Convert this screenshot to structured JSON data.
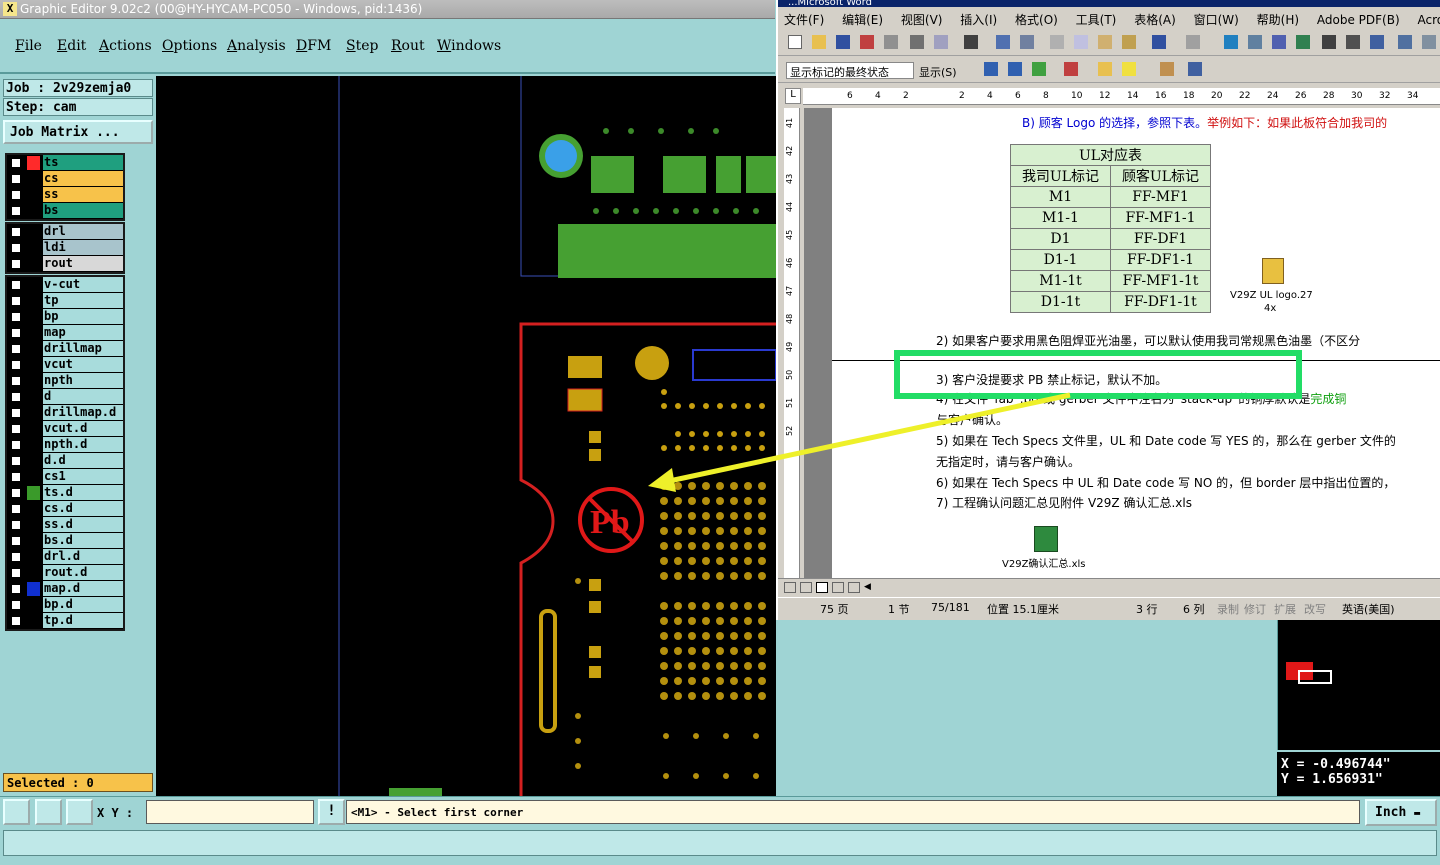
{
  "ge_title": "Graphic Editor 9.02c2 (00@HY-HYCAM-PC050 - Windows, pid:1436)",
  "ge_menu": [
    "File",
    "Edit",
    "Actions",
    "Options",
    "Analysis",
    "DFM",
    "Step",
    "Rout",
    "Windows"
  ],
  "job": "Job : 2v29zemja0",
  "step": "Step: cam",
  "job_matrix": "Job Matrix ...",
  "layer_groups": [
    [
      {
        "name": "ts",
        "color": "#1f9f7f",
        "mark": "#ff2a2a"
      },
      {
        "name": "cs",
        "color": "#f7c24a",
        "mark": ""
      },
      {
        "name": "ss",
        "color": "#f7c24a",
        "mark": ""
      },
      {
        "name": "bs",
        "color": "#1f9f7f",
        "mark": ""
      }
    ],
    [
      {
        "name": "drl",
        "color": "#a8c4cc",
        "mark": ""
      },
      {
        "name": "ldi",
        "color": "#a8c4cc",
        "mark": ""
      },
      {
        "name": "rout",
        "color": "#d8d8d8",
        "mark": ""
      }
    ],
    [
      {
        "name": "v-cut",
        "color": "#a8dcdc",
        "mark": ""
      },
      {
        "name": "tp",
        "color": "#a8dcdc",
        "mark": ""
      },
      {
        "name": "bp",
        "color": "#a8dcdc",
        "mark": ""
      },
      {
        "name": "map",
        "color": "#a8dcdc",
        "mark": ""
      },
      {
        "name": "drillmap",
        "color": "#a8dcdc",
        "mark": ""
      },
      {
        "name": "vcut",
        "color": "#a8dcdc",
        "mark": ""
      },
      {
        "name": "npth",
        "color": "#a8dcdc",
        "mark": ""
      },
      {
        "name": "d",
        "color": "#a8dcdc",
        "mark": ""
      },
      {
        "name": "drillmap.d",
        "color": "#a8dcdc",
        "mark": ""
      },
      {
        "name": "vcut.d",
        "color": "#a8dcdc",
        "mark": ""
      },
      {
        "name": "npth.d",
        "color": "#a8dcdc",
        "mark": ""
      },
      {
        "name": "d.d",
        "color": "#a8dcdc",
        "mark": ""
      },
      {
        "name": "cs1",
        "color": "#a8dcdc",
        "mark": ""
      },
      {
        "name": "ts.d",
        "color": "#a8dcdc",
        "mark": "#3a9a2a"
      },
      {
        "name": "cs.d",
        "color": "#a8dcdc",
        "mark": ""
      },
      {
        "name": "ss.d",
        "color": "#a8dcdc",
        "mark": ""
      },
      {
        "name": "bs.d",
        "color": "#a8dcdc",
        "mark": ""
      },
      {
        "name": "drl.d",
        "color": "#a8dcdc",
        "mark": ""
      },
      {
        "name": "rout.d",
        "color": "#a8dcdc",
        "mark": ""
      },
      {
        "name": "map.d",
        "color": "#a8dcdc",
        "mark": "#1030d0"
      },
      {
        "name": "bp.d",
        "color": "#a8dcdc",
        "mark": ""
      },
      {
        "name": "tp.d",
        "color": "#a8dcdc",
        "mark": ""
      }
    ]
  ],
  "selected": "Selected : 0",
  "pcb_label": "Pb",
  "word": {
    "title": "...Microsoft Word",
    "menu": [
      "文件(F)",
      "编辑(E)",
      "视图(V)",
      "插入(I)",
      "格式(O)",
      "工具(T)",
      "表格(A)",
      "窗口(W)",
      "帮助(H)",
      "Adobe PDF(B)",
      "Acroba"
    ],
    "markup_state": "显示标记的最终状态",
    "show": "显示(S)",
    "ruler_ticks": [
      "6",
      "4",
      "2",
      "",
      "2",
      "4",
      "6",
      "8",
      "10",
      "12",
      "14",
      "16",
      "18",
      "20",
      "22",
      "24",
      "26",
      "28",
      "30",
      "32",
      "34"
    ],
    "vruler_ticks": [
      "41",
      "42",
      "43",
      "44",
      "45",
      "46",
      "47",
      "48",
      "49",
      "50",
      "51",
      "52"
    ],
    "line_b": "B) 顾客 Logo 的选择，参照下表。",
    "line_b_red": "举例如下：如果此板符合加我司的",
    "table_title": "UL对应表",
    "table_headers": [
      "我司UL标记",
      "顾客UL标记"
    ],
    "table_rows": [
      [
        "M1",
        "FF-MF1"
      ],
      [
        "M1-1",
        "FF-MF1-1"
      ],
      [
        "D1",
        "FF-DF1"
      ],
      [
        "D1-1",
        "FF-DF1-1"
      ],
      [
        "M1-1t",
        "FF-MF1-1t"
      ],
      [
        "D1-1t",
        "FF-DF1-1t"
      ]
    ],
    "attach1": "V29Z UL logo.27",
    "attach1_sub": "4x",
    "line2": "2) 如果客户要求用黑色阻焊亚光油墨，可以默认使用我司常规黑色油墨（不区分",
    "line3": "3) 客户没提要求 PB 禁止标记，默认不加。",
    "line4a": "4) 在文件“fab”.pdf或 gerber 文件中注名为“stack-up”的铜厚默认是",
    "line4a_green": "完成铜",
    "line4b": "与客户确认。",
    "line5a": "5) 如果在 Tech Specs 文件里，UL 和 Date code 写 YES 的，那么在 gerber 文件的",
    "line5b": "无指定时，请与客户确认。",
    "line6": "6) 如果在 Tech Specs 中 UL 和 Date code 写 NO 的，但 border 层中指出位置的，",
    "line7": "7) 工程确认问题汇总见附件 V29Z 确认汇总.xls",
    "attach2": "V29Z确认汇总.xls",
    "status": {
      "page": "75 页",
      "section": "1 节",
      "pages": "75/181",
      "pos": "位置 15.1厘米",
      "line": "3 行",
      "col": "6 列",
      "rec": "录制",
      "rev": "修订",
      "ext": "扩展",
      "ovr": "改写",
      "lang": "英语(美国)"
    }
  },
  "bottom": {
    "xy_label": "X Y :",
    "xy_value": "",
    "prompt": "<M1> - Select first corner",
    "units": "Inch",
    "coord": "X = -0.496744\"\nY = 1.656931\""
  }
}
